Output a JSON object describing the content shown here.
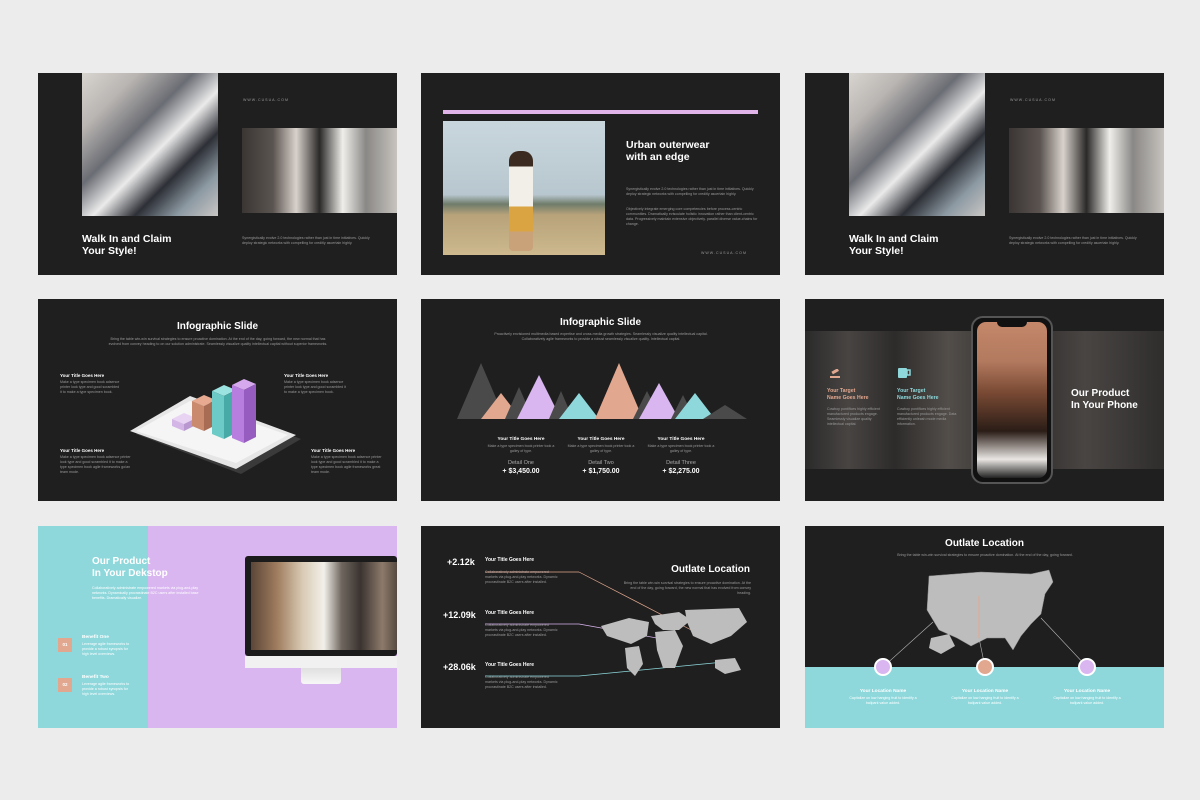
{
  "colors": {
    "bg": "#ececec",
    "slide": "#1f1f1f",
    "pink": "#e0b4e8",
    "teal": "#8ed8dc",
    "peach": "#e2a78f",
    "lilac": "#d9b6f0"
  },
  "s1": {
    "url": "WWW.CUSUA.COM",
    "title1": "Walk In and Claim",
    "title2": "Your Style!",
    "body": "Synergistically evolve 2.0 technologies rather than just in time initiatives. Quickly deploy strategic networks with compelling for creditly ascertain highly."
  },
  "s2": {
    "title1": "Urban outerwear",
    "title2": "with an edge",
    "body1": "Synergistically evolve 2.0 technologies rather than just in time initiatives. Quickly deploy strategic networks with compelling for creditly ascertain highly.",
    "body2": "Objectively integrate emerging core competencies before process-centric communities. Dramatically evisculate holistic innovation rather than client-centric data. Progressively maintain extensive objectively. parallel diverse value-chains for change.",
    "url": "WWW.CUSUA.COM"
  },
  "s3": {
    "url": "WWW.CUSUA.COM",
    "title1": "Walk In and Claim",
    "title2": "Your Style!",
    "body": "Synergistically evolve 2.0 technologies rather than just in time initiatives. Quickly deploy strategic networks with compelling for creditly ascertain highly."
  },
  "s4": {
    "title": "Infographic Slide",
    "sub": "Bring the table win-win survival strategies to ensure proactive domination. At the end of the day, going forward, the new normal that has evolved from convey heading to on our solution administrate. Seamlessly visualize quality intellectual capital without superior frameworks.",
    "items": [
      {
        "title": "Your Title Goes Here",
        "body": "Make a type specimen book adsence printer look type and good scrambled it to make a type specimen book."
      },
      {
        "title": "Your Title Goes Here",
        "body": "Make a type specimen book adsence printer look type and good scrambled it to make a type specimen book."
      },
      {
        "title": "Your Title Goes Here",
        "body": "Make a type specimen book adsence printer look type and good scrambled it to make a type specimen book agile frameworks go/an team mode."
      },
      {
        "title": "Your Title Goes Here",
        "body": "Make a type specimen book adsence printer look type and good scrambled it to make a type specimen book agile frameworks great team mode."
      }
    ]
  },
  "s5": {
    "title": "Infographic Slide",
    "sub": "Proactively envisioned multimedia based expertise and cross-media growth strategies. Seamlessly visualize quality intellectual capital. Collaboratively agile frameworks to provide a robust seamlessly visualize quality. Intellectual capital.",
    "cols": [
      {
        "title": "Your Title Goes Here",
        "body": "Make a type specimen book printer took a galley of type.",
        "label": "Detail One",
        "value": "+ $3,450.00"
      },
      {
        "title": "Your Title Goes Here",
        "body": "Make a type specimen book printer took a galley of type.",
        "label": "Detail Two",
        "value": "+ $1,750.00"
      },
      {
        "title": "Your Title Goes Here",
        "body": "Make a type specimen book printer took a galley of type.",
        "label": "Detail Three",
        "value": "+ $2,275.00"
      }
    ]
  },
  "s6": {
    "t1a": "Your Target",
    "t1b": "Name Goes Here",
    "t2a": "Your Target",
    "t2b": "Name Goes Here",
    "b1": "Cowboy pontifices highly efficient manufactured products engage. Seamlessly visualize quality intellectual capital.",
    "b2": "Cowboy pontifices highly efficient manufactured products engage. Data efficiently unleash mode media information.",
    "title1": "Our Product",
    "title2": "In Your Phone"
  },
  "s7": {
    "title1": "Our Product",
    "title2": "In Your Dekstop",
    "body": "Collaboratively administrate empowered markets via plug-and-play networks. Dynamically procrastinate B2C users after installed base benefits. Dramatically visualize.",
    "r1": "Benefit One",
    "r1b": "Leverage agile frameworks to provide a robust synopsis for high level overviews.",
    "r2": "Benefit Two",
    "r2b": "Leverage agile frameworks to provide a robust synopsis for high level overviews.",
    "n1": "01",
    "n2": "02"
  },
  "s8": {
    "title": "Outlate Location",
    "sub": "Bring the table win-win survival strategies to ensure proactive domination. At the end of the day, going forward, the new normal that has evolved from convey heading.",
    "stats": [
      {
        "value": "+2.12k",
        "title": "Your Title Goes Here",
        "body": "Collaboratively administrate empowered markets via plug-and-play networks. Dynamic procrastinate B2C users after installed."
      },
      {
        "value": "+12.09k",
        "title": "Your Title Goes Here",
        "body": "Collaboratively administrate empowered markets via plug-and-play networks. Dynamic procrastinate B2C users after installed."
      },
      {
        "value": "+28.06k",
        "title": "Your Title Goes Here",
        "body": "Collaboratively administrate empowered markets via plug-and-play networks. Dynamic procrastinate B2C users after installed."
      }
    ]
  },
  "s9": {
    "title": "Outlate Location",
    "sub": "Bring the table win-win survival strategies to ensure proactive domination. At the end of the day, going forward.",
    "locs": [
      {
        "name": "Your Location Name",
        "body": "Capitalize on low hanging fruit to identify a ballpark value added."
      },
      {
        "name": "Your Location Name",
        "body": "Capitalize on low hanging fruit to identify a ballpark value added."
      },
      {
        "name": "Your Location Name",
        "body": "Capitalize on low hanging fruit to identify a ballpark value added."
      }
    ]
  }
}
